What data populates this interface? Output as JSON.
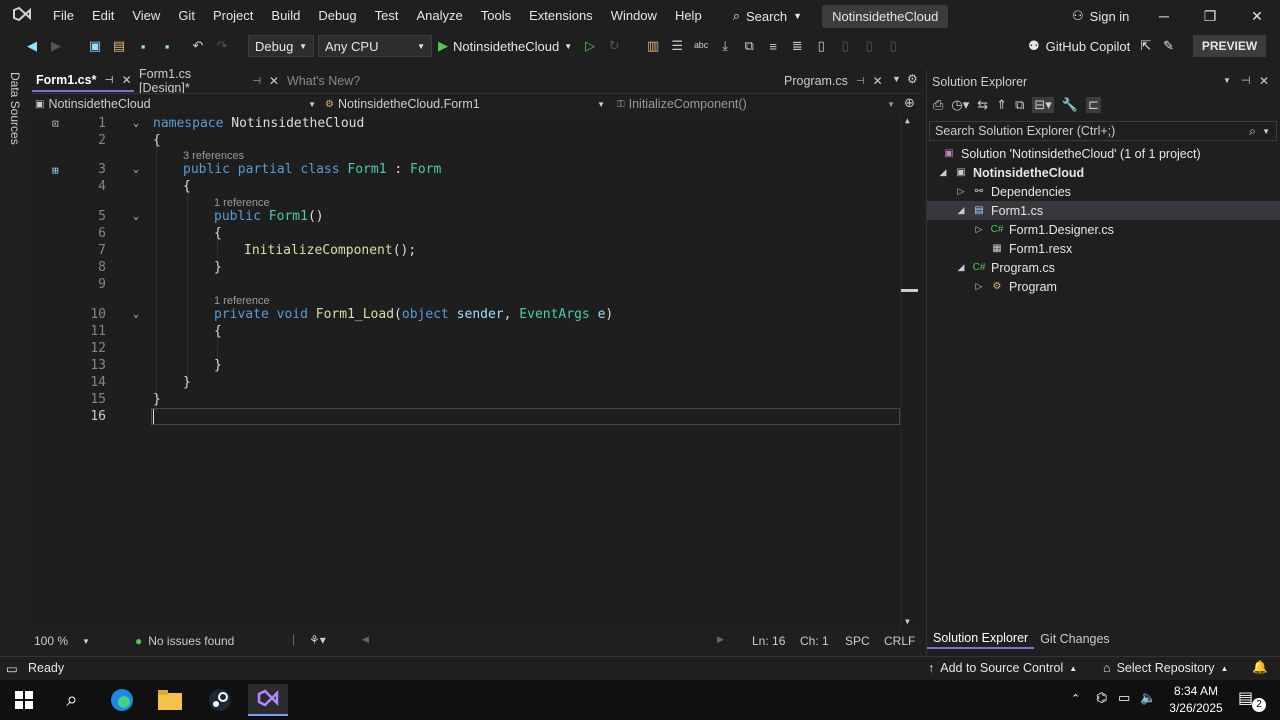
{
  "menu": [
    "File",
    "Edit",
    "View",
    "Git",
    "Project",
    "Build",
    "Debug",
    "Test",
    "Analyze",
    "Tools",
    "Extensions",
    "Window",
    "Help"
  ],
  "search_label": "Search",
  "title_project": "NotinsidetheCloud",
  "sign_in": "Sign in",
  "toolbar": {
    "config": "Debug",
    "platform": "Any CPU",
    "run_target": "NotinsidetheCloud",
    "copilot": "GitHub Copilot",
    "preview": "PREVIEW"
  },
  "left_sidebar": "Data Sources",
  "tabs": {
    "t1": "Form1.cs*",
    "t2": "Form1.cs [Design]*",
    "t3": "What's New?",
    "t4": "Program.cs"
  },
  "nav": {
    "project": "NotinsidetheCloud",
    "class": "NotinsidetheCloud.Form1",
    "member": "InitializeComponent()"
  },
  "code": {
    "refs3": "3 references",
    "refs1a": "1 reference",
    "refs1b": "1 reference",
    "kw_namespace": "namespace",
    "ns_name": "NotinsidetheCloud",
    "brace_open": "{",
    "brace_close": "}",
    "kw_public": "public",
    "kw_partial": "partial",
    "kw_class": "class",
    "cls_name": "Form1",
    "colon": ":",
    "base": "Form",
    "ctor_name": "Form1",
    "parens": "()",
    "init_call": "InitializeComponent",
    "init_tail": "();",
    "kw_private": "private",
    "kw_void": "void",
    "load_name": "Form1_Load",
    "open_paren": "(",
    "kw_object": "object",
    "p_sender": "sender",
    "comma": ",",
    "t_eventargs": "EventArgs",
    "p_e": "e",
    "close_paren": ")"
  },
  "line_numbers": [
    "1",
    "2",
    "3",
    "4",
    "5",
    "6",
    "7",
    "8",
    "9",
    "10",
    "11",
    "12",
    "13",
    "14",
    "15",
    "16"
  ],
  "editor_status": {
    "zoom": "100 %",
    "issues": "No issues found",
    "ln": "Ln: 16",
    "ch": "Ch: 1",
    "spc": "SPC",
    "crlf": "CRLF"
  },
  "solution_explorer": {
    "title": "Solution Explorer",
    "search_placeholder": "Search Solution Explorer (Ctrl+;)",
    "solution": "Solution 'NotinsidetheCloud' (1 of 1 project)",
    "project": "NotinsidetheCloud",
    "dependencies": "Dependencies",
    "form1": "Form1.cs",
    "designer": "Form1.Designer.cs",
    "resx": "Form1.resx",
    "program": "Program.cs",
    "program_class": "Program",
    "tab1": "Solution Explorer",
    "tab2": "Git Changes"
  },
  "statusbar": {
    "ready": "Ready",
    "source_control": "Add to Source Control",
    "repository": "Select Repository",
    "notif_count": "2"
  },
  "clock": {
    "time": "8:34 AM",
    "date": "3/26/2025"
  }
}
